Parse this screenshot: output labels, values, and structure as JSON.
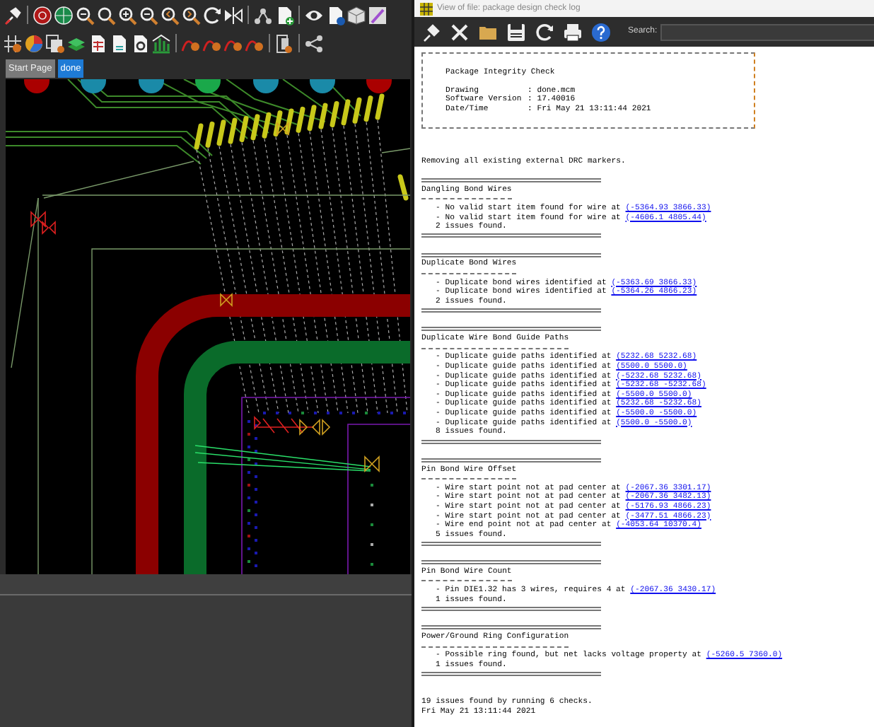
{
  "editor": {
    "tabs": [
      {
        "label": "Start Page",
        "selected": false
      },
      {
        "label": "done",
        "selected": true
      }
    ]
  },
  "log_window": {
    "title": "View of file: package design check log",
    "search": {
      "label": "Search:"
    },
    "header": {
      "title": "Package Integrity Check",
      "fields": [
        {
          "label": "Drawing",
          "value": ": done.mcm"
        },
        {
          "label": "Software Version",
          "value": ": 17.40016"
        },
        {
          "label": "Date/Time",
          "value": ": Fri May 21 13:11:44 2021"
        }
      ]
    },
    "intro": "Removing all existing external DRC markers.",
    "sections": [
      {
        "title": "Dangling Bond Wires",
        "items": [
          {
            "text": "- No valid start item found for wire at",
            "link": "(-5364.93 3866.33)"
          },
          {
            "text": "- No valid start item found for wire at",
            "link": "(-4606.1 4805.44)"
          }
        ],
        "summary": "2 issues found."
      },
      {
        "title": "Duplicate Bond Wires",
        "items": [
          {
            "text": "- Duplicate bond wires identified at",
            "link": "(-5363.69 3866.33)"
          },
          {
            "text": "- Duplicate bond wires identified at",
            "link": "(-5364.26 4866.23)"
          }
        ],
        "summary": "2 issues found."
      },
      {
        "title": "Duplicate Wire Bond Guide Paths",
        "items": [
          {
            "text": "- Duplicate guide paths identified at",
            "link": "(5232.68 5232.68)"
          },
          {
            "text": "- Duplicate guide paths identified at",
            "link": "(5500.0 5500.0)"
          },
          {
            "text": "- Duplicate guide paths identified at",
            "link": "(-5232.68 5232.68)"
          },
          {
            "text": "- Duplicate guide paths identified at",
            "link": "(-5232.68 -5232.68)"
          },
          {
            "text": "- Duplicate guide paths identified at",
            "link": "(-5500.0 5500.0)"
          },
          {
            "text": "- Duplicate guide paths identified at",
            "link": "(5232.68 -5232.68)"
          },
          {
            "text": "- Duplicate guide paths identified at",
            "link": "(-5500.0 -5500.0)"
          },
          {
            "text": "- Duplicate guide paths identified at",
            "link": "(5500.0 -5500.0)"
          }
        ],
        "summary": "8 issues found."
      },
      {
        "title": "Pin Bond Wire Offset",
        "items": [
          {
            "text": "- Wire start point not at pad center at",
            "link": "(-2067.36 3301.17)"
          },
          {
            "text": "- Wire start point not at pad center at",
            "link": "(-2067.36 3482.13)"
          },
          {
            "text": "- Wire start point not at pad center at",
            "link": "(-5176.93 4866.23)"
          },
          {
            "text": "- Wire start point not at pad center at",
            "link": "(-3477.51 4866.23)"
          },
          {
            "text": "- Wire end point not at pad center at",
            "link": "(-4053.64 10370.4)"
          }
        ],
        "summary": "5 issues found."
      },
      {
        "title": "Pin Bond Wire Count",
        "items": [
          {
            "text": "- Pin DIE1.32 has 3 wires, requires 4 at",
            "link": "(-2067.36 3430.17)"
          }
        ],
        "summary": "1 issues found."
      },
      {
        "title": "Power/Ground Ring Configuration",
        "items": [
          {
            "text": "- Possible ring found, but net lacks voltage property at",
            "link": "(-5260.5 7360.0)"
          }
        ],
        "summary": "1 issues found."
      }
    ],
    "footer": [
      "19 issues found by running 6 checks.",
      "Fri May 21 13:11:44 2021"
    ]
  }
}
